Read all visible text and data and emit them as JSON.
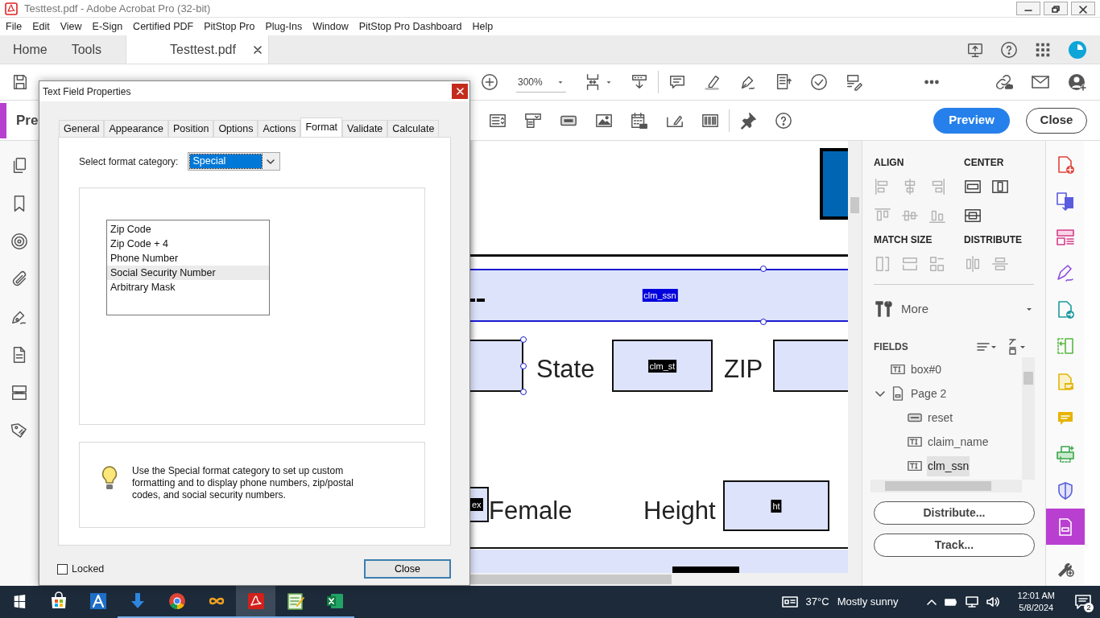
{
  "window": {
    "title": "Testtest.pdf - Adobe Acrobat Pro (32-bit)"
  },
  "menu": [
    "File",
    "Edit",
    "View",
    "E-Sign",
    "Certified PDF",
    "PitStop Pro",
    "Plug-Ins",
    "Window",
    "PitStop Pro Dashboard",
    "Help"
  ],
  "app_tabs": [
    {
      "label": "Home",
      "selected": false
    },
    {
      "label": "Tools",
      "selected": false
    },
    {
      "label": "Testtest.pdf",
      "selected": true
    }
  ],
  "toolbar": {
    "zoom": "300%"
  },
  "tool_title": "Pre",
  "form_buttons": [
    {
      "label": "Preview",
      "kind": "primary"
    },
    {
      "label": "Close",
      "kind": "outline"
    }
  ],
  "document": {
    "labels": [
      "State",
      "ZIP",
      "Female",
      "Height"
    ],
    "fields": [
      {
        "kind": "band",
        "label": "clm_ssn",
        "selected": true
      },
      {
        "kind": "box",
        "selected": true
      },
      {
        "kind": "box",
        "label": "clm_st",
        "selected": false
      },
      {
        "kind": "box"
      },
      {
        "kind": "box",
        "label": "ex",
        "selected": false
      },
      {
        "kind": "box",
        "label": "ht",
        "selected": false
      }
    ]
  },
  "right_panel": {
    "groups": [
      {
        "title": "ALIGN",
        "tools": [
          {
            "kind": "left",
            "disabled": true
          },
          {
            "kind": "hcenter",
            "disabled": true
          },
          {
            "kind": "right",
            "disabled": true
          },
          {
            "kind": "top",
            "disabled": true
          },
          {
            "kind": "vcenter",
            "disabled": true
          },
          {
            "kind": "bottom",
            "disabled": true
          }
        ]
      },
      {
        "title": "CENTER",
        "tools": [
          {
            "kind": "chorizontal",
            "disabled": false
          },
          {
            "kind": "cvertical",
            "disabled": false
          },
          {
            "kind": "cboth",
            "disabled": false
          }
        ]
      },
      {
        "title": "MATCH SIZE",
        "tools": [
          {
            "kind": "mwidth",
            "disabled": true
          },
          {
            "kind": "mheight",
            "disabled": true
          },
          {
            "kind": "mboth",
            "disabled": true
          }
        ]
      },
      {
        "title": "DISTRIBUTE",
        "tools": [
          {
            "kind": "dhorizontal",
            "disabled": true
          },
          {
            "kind": "dvertical",
            "disabled": true
          }
        ]
      }
    ],
    "more": "More",
    "fields_title": "FIELDS",
    "tree": [
      {
        "label": "box#0",
        "kind": "text",
        "selected": false
      },
      {
        "label": "Page 2",
        "kind": "page",
        "selected": false,
        "expanded": true,
        "children": [
          {
            "label": "reset",
            "kind": "button",
            "selected": false
          },
          {
            "label": "claim_name",
            "kind": "text",
            "selected": false
          },
          {
            "label": "clm_ssn",
            "kind": "text",
            "selected": true
          }
        ]
      }
    ],
    "buttons": [
      "Distribute...",
      "Track..."
    ]
  },
  "tool_strip": [
    {
      "kind": "create",
      "selected": false
    },
    {
      "kind": "combine",
      "selected": false
    },
    {
      "kind": "organize",
      "selected": false
    },
    {
      "kind": "sign",
      "selected": false
    },
    {
      "kind": "export",
      "selected": false
    },
    {
      "kind": "compare",
      "selected": false
    },
    {
      "kind": "comment-page",
      "selected": false
    },
    {
      "kind": "comment",
      "selected": false
    },
    {
      "kind": "print",
      "selected": false
    },
    {
      "kind": "protect",
      "selected": false
    },
    {
      "kind": "prepare",
      "selected": true
    },
    {
      "kind": "add",
      "selected": false
    }
  ],
  "dialog": {
    "title": "Text Field Properties",
    "tabs": [
      {
        "label": "General",
        "selected": false
      },
      {
        "label": "Appearance",
        "selected": false
      },
      {
        "label": "Position",
        "selected": false
      },
      {
        "label": "Options",
        "selected": false
      },
      {
        "label": "Actions",
        "selected": false
      },
      {
        "label": "Format",
        "selected": true
      },
      {
        "label": "Validate",
        "selected": false
      },
      {
        "label": "Calculate",
        "selected": false
      }
    ],
    "category_label": "Select format category:",
    "category": "Special",
    "options": [
      {
        "label": "Zip Code",
        "selected": false
      },
      {
        "label": "Zip Code + 4",
        "selected": false
      },
      {
        "label": "Phone Number",
        "selected": false
      },
      {
        "label": "Social Security Number",
        "selected": true
      },
      {
        "label": "Arbitrary Mask",
        "selected": false
      }
    ],
    "hint": "Use the Special format category to set up custom formatting and to display phone numbers, zip/postal codes, and social security numbers.",
    "locked": {
      "label": "Locked",
      "checked": false
    },
    "close": "Close"
  },
  "taskbar": {
    "apps": [
      {
        "kind": "store",
        "running": false,
        "active": false
      },
      {
        "kind": "azure",
        "running": false,
        "active": false
      },
      {
        "kind": "download",
        "running": true,
        "active": false
      },
      {
        "kind": "chrome",
        "running": true,
        "active": false
      },
      {
        "kind": "infinity",
        "running": true,
        "active": false
      },
      {
        "kind": "acrobat",
        "running": true,
        "active": true
      },
      {
        "kind": "notepad",
        "running": true,
        "active": false
      },
      {
        "kind": "excel",
        "running": true,
        "active": false
      }
    ],
    "temperature": "37°C",
    "weather": "Mostly sunny",
    "time": "12:01 AM",
    "date": "5/8/2024",
    "notifications": "2"
  }
}
